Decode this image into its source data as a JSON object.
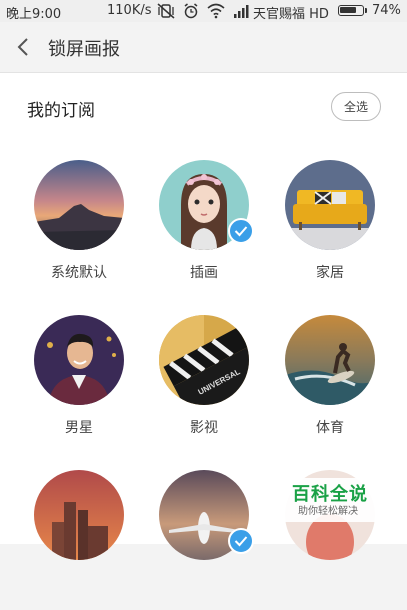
{
  "status_bar": {
    "time": "晚上9:00",
    "speed": "110K/s",
    "carrier": "天官赐福 HD",
    "battery": "74%",
    "battery_level": 0.74
  },
  "header": {
    "title": "锁屏画报"
  },
  "subscriptions": {
    "title": "我的订阅",
    "select_all_label": "全选",
    "items": [
      {
        "label": "系统默认",
        "checked": false
      },
      {
        "label": "插画",
        "checked": true
      },
      {
        "label": "家居",
        "checked": false
      },
      {
        "label": "男星",
        "checked": false
      },
      {
        "label": "影视",
        "checked": false
      },
      {
        "label": "体育",
        "checked": false
      },
      {
        "label": "",
        "checked": false
      },
      {
        "label": "",
        "checked": true
      },
      {
        "label": "",
        "checked": false
      }
    ]
  },
  "watermark": {
    "title": "百科全说",
    "subtitle": "助你轻松解决"
  },
  "colors": {
    "accent": "#3a9fe8",
    "watermark_green": "#1aa146"
  }
}
